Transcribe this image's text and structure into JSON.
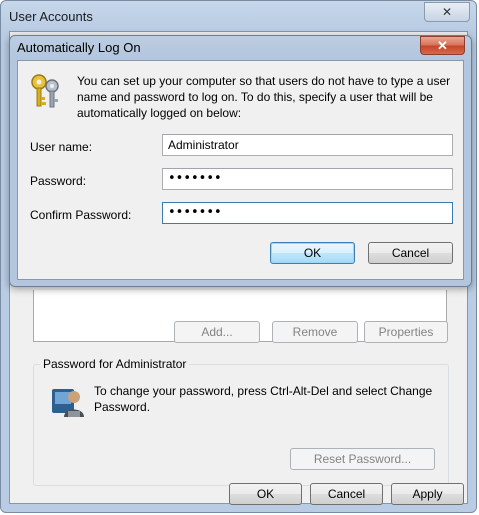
{
  "back_window": {
    "title": "User Accounts",
    "close_glyph": "✕",
    "buttons": {
      "add": "Add...",
      "remove": "Remove",
      "properties": "Properties"
    },
    "password_group": {
      "legend": "Password for Administrator",
      "message": "To change your password, press Ctrl-Alt-Del and select Change Password.",
      "reset_button": "Reset Password..."
    },
    "footer": {
      "ok": "OK",
      "cancel": "Cancel",
      "apply": "Apply"
    }
  },
  "dialog": {
    "title": "Automatically Log On",
    "close_glyph": "✕",
    "description": "You can set up your computer so that users do not have to type a user name and password to log on. To do this, specify a user that will be automatically logged on below:",
    "fields": {
      "username_label": "User name:",
      "username_value": "Administrator",
      "password_label": "Password:",
      "password_value": "•••••••",
      "confirm_label": "Confirm Password:",
      "confirm_value": "•••••••"
    },
    "ok": "OK",
    "cancel": "Cancel"
  },
  "icons": {
    "dialog_icon": "keys-icon",
    "password_icon": "user-password-icon"
  }
}
